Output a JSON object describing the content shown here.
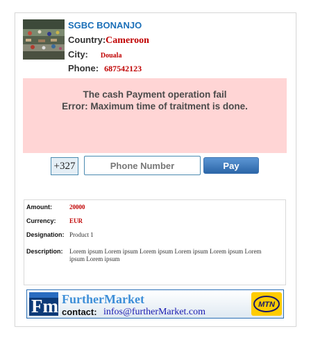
{
  "merchant": {
    "name": "SGBC BONANJO",
    "country_label": "Country:",
    "country_value": "Cameroon",
    "city_label": "City:",
    "city_value": "Douala",
    "phone_label": "Phone:",
    "phone_value": "687542123"
  },
  "error": {
    "line1": "The cash Payment operation fail",
    "line2": "Error: Maximum time of traitment is done."
  },
  "payment": {
    "prefix": "+327",
    "phone_placeholder": "Phone Number",
    "pay_label": "Pay"
  },
  "details": {
    "amount_label": "Amount:",
    "amount_value": "20000",
    "currency_label": "Currency:",
    "currency_value": "EUR",
    "designation_label": "Designation:",
    "designation_value": "Product 1",
    "description_label": "Description:",
    "description_value": "Lorem ipsum Lorem ipsum Lorem ipsum Lorem ipsum Lorem ipsum Lorem ipsum Lorem ipsum"
  },
  "footer": {
    "brand": "FurtherMarket",
    "logo_text": "Fm",
    "contact_label": "contact:",
    "contact_email": "infos@furtherMarket.com",
    "partner_logo": "MTN"
  },
  "colors": {
    "accent": "#1a6fb8",
    "value_red": "#c00000",
    "error_bg": "#ffd5d5",
    "mtn_yellow": "#ffcc00"
  }
}
